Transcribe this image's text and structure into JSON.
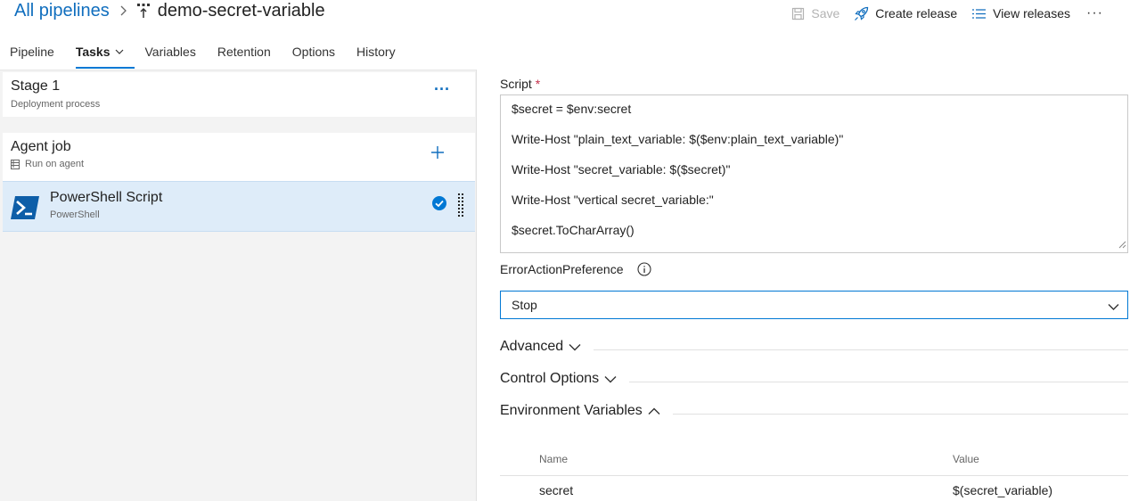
{
  "breadcrumb": {
    "all_pipelines": "All pipelines",
    "pipeline_name": "demo-secret-variable"
  },
  "toolbar": {
    "save_label": "Save",
    "create_release_label": "Create release",
    "view_releases_label": "View releases",
    "more_label": "···"
  },
  "tabs": [
    {
      "label": "Pipeline"
    },
    {
      "label": "Tasks"
    },
    {
      "label": "Variables"
    },
    {
      "label": "Retention"
    },
    {
      "label": "Options"
    },
    {
      "label": "History"
    }
  ],
  "stage": {
    "title": "Stage 1",
    "subtitle": "Deployment process",
    "more": "···"
  },
  "agent_job": {
    "title": "Agent job",
    "subtitle": "Run on agent"
  },
  "task": {
    "title": "PowerShell Script",
    "subtitle": "PowerShell"
  },
  "script": {
    "label": "Script",
    "required_mark": "*",
    "lines": [
      "$secret = $env:secret",
      "Write-Host \"plain_text_variable: $($env:plain_text_variable)\"",
      "Write-Host \"secret_variable: $($secret)\"",
      "Write-Host \"vertical secret_variable:\"",
      "$secret.ToCharArray()"
    ]
  },
  "error_action": {
    "label": "ErrorActionPreference",
    "value": "Stop"
  },
  "sections": {
    "advanced": "Advanced",
    "control_options": "Control Options",
    "environment_variables": "Environment Variables"
  },
  "env_table": {
    "headers": {
      "name": "Name",
      "value": "Value"
    },
    "rows": [
      {
        "name": "secret",
        "value": "$(secret_variable)"
      }
    ]
  },
  "colors": {
    "accent": "#0078d4",
    "link": "#106ebe",
    "selected_row": "#deecf9",
    "required": "#c4314b"
  }
}
